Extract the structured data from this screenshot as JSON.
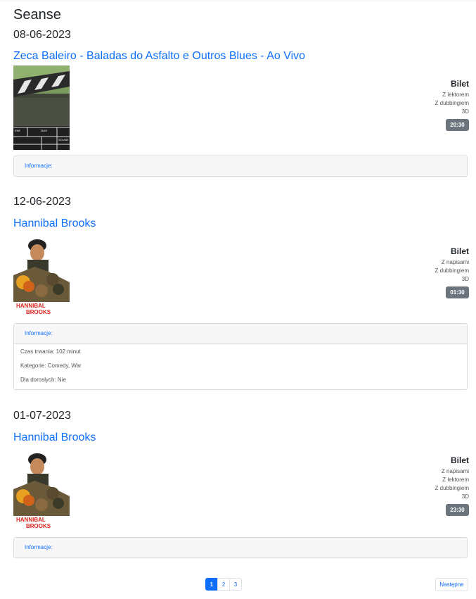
{
  "title": "Seanse",
  "screenings": [
    {
      "date": "08-06-2023",
      "movie_title": "Zeca Baleiro - Baladas do Asfalto e Outros Blues - Ao Vivo",
      "poster": "clapperboard-poster",
      "ticket_title": "Bilet",
      "options": [
        "Z lektorem",
        "Z dubbingiem",
        "3D"
      ],
      "time": "20:30",
      "info_label": "Informacje:",
      "details": []
    },
    {
      "date": "12-06-2023",
      "movie_title": "Hannibal Brooks",
      "poster": "hannibal-brooks-poster",
      "poster_text": [
        "HANNIBAL",
        "BROOKS"
      ],
      "ticket_title": "Bilet",
      "options": [
        "Z napisami",
        "Z dubbingiem",
        "3D"
      ],
      "time": "01:30",
      "info_label": "Informacje:",
      "details": [
        "Czas trwania: 102 minut",
        "Kategorie: Comedy, War",
        "Dla dorosłych: Nie"
      ]
    },
    {
      "date": "01-07-2023",
      "movie_title": "Hannibal Brooks",
      "poster": "hannibal-brooks-poster",
      "poster_text": [
        "HANNIBAL",
        "BROOKS"
      ],
      "ticket_title": "Bilet",
      "options": [
        "Z napisami",
        "Z lektorem",
        "Z dubbingiem",
        "3D"
      ],
      "time": "23:30",
      "info_label": "Informacje:",
      "details": []
    }
  ],
  "pagination": {
    "pages": [
      "1",
      "2",
      "3"
    ],
    "active_page": "1",
    "next_label": "Następne"
  },
  "clapper_text": [
    "ENE",
    "TAKE",
    "SOUND"
  ],
  "colors": {
    "link": "#0d6efd",
    "time_button": "#6c757d",
    "card_header": "#f7f7f7"
  }
}
